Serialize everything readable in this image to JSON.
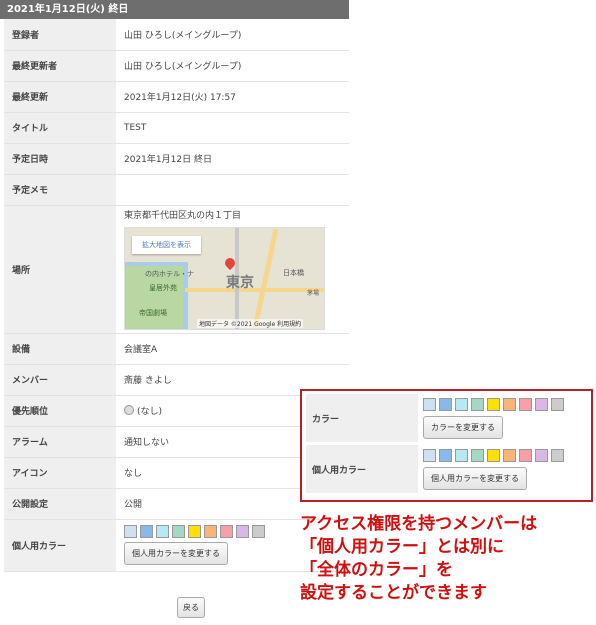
{
  "header": {
    "title": "2021年1月12日(火) 終日"
  },
  "rows": {
    "registrant": {
      "label": "登録者",
      "value": "山田 ひろし(メイングループ)"
    },
    "updater": {
      "label": "最終更新者",
      "value": "山田 ひろし(メイングループ)"
    },
    "updated": {
      "label": "最終更新",
      "value": "2021年1月12日(火) 17:57"
    },
    "title": {
      "label": "タイトル",
      "value": "TEST"
    },
    "schedule": {
      "label": "予定日時",
      "value": "2021年1月12日 終日"
    },
    "memo": {
      "label": "予定メモ",
      "value": ""
    },
    "place": {
      "label": "場所",
      "address": "東京都千代田区丸の内１丁目",
      "map": {
        "button": "拡大地図を表示",
        "center_label": "東京",
        "label_hotel": "の内ホテル・ナ",
        "label_palace": "皇居外苑",
        "label_theatre": "帝国劇場",
        "label_nihonbashi": "日本橋",
        "label_kayaba": "茅場",
        "footer": "地図データ ©2021 Google   利用規約"
      }
    },
    "facility": {
      "label": "設備",
      "value": "会議室A"
    },
    "members": {
      "label": "メンバー",
      "value": "斎藤 きよし"
    },
    "priority": {
      "label": "優先順位",
      "value": "(なし)"
    },
    "alarm": {
      "label": "アラーム",
      "value": "通知しない"
    },
    "icon": {
      "label": "アイコン",
      "value": "なし"
    },
    "visibility": {
      "label": "公開設定",
      "value": "公開"
    },
    "personal_color": {
      "label": "個人用カラー",
      "button": "個人用カラーを変更する"
    }
  },
  "back_button": "戻る",
  "colors": [
    "#cfe0f3",
    "#8ab8e8",
    "#b7e9f4",
    "#a4d8c4",
    "#ffe000",
    "#f9b47a",
    "#f7a0a8",
    "#d9b8e6",
    "#cccccc"
  ],
  "callout": {
    "color_label": "カラー",
    "color_button": "カラーを変更する",
    "personal_label": "個人用カラー",
    "personal_button": "個人用カラーを変更する",
    "line1": "アクセス権限を持つメンバーは",
    "line2": "「個人用カラー」とは別に",
    "line3": "「全体のカラー」を",
    "line4": "設定することができます"
  }
}
